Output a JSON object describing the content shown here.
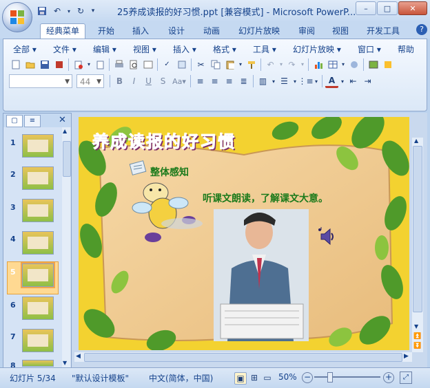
{
  "window": {
    "title": "25养成读报的好习惯.ppt [兼容模式] - Microsoft PowerP..."
  },
  "ribbon_tabs": [
    {
      "label": "经典菜单",
      "active": true
    },
    {
      "label": "开始"
    },
    {
      "label": "插入"
    },
    {
      "label": "设计"
    },
    {
      "label": "动画"
    },
    {
      "label": "幻灯片放映"
    },
    {
      "label": "审阅"
    },
    {
      "label": "视图"
    },
    {
      "label": "开发工具"
    }
  ],
  "classic_menu": [
    "全部",
    "文件",
    "编辑",
    "视图",
    "插入",
    "格式",
    "工具",
    "幻灯片放映",
    "窗口",
    "帮助"
  ],
  "font": {
    "name_placeholder": "",
    "size": "44"
  },
  "left_pane": {
    "slides": [
      {
        "num": "1"
      },
      {
        "num": "2"
      },
      {
        "num": "3"
      },
      {
        "num": "4"
      },
      {
        "num": "5",
        "selected": true
      },
      {
        "num": "6"
      },
      {
        "num": "7"
      },
      {
        "num": "8"
      }
    ]
  },
  "slide": {
    "title": "养成读报的好习惯",
    "section_label": "整体感知",
    "instruction": "听课文朗读，了解课文大意。"
  },
  "status": {
    "slide_counter": "幻灯片 5/34",
    "theme": "\"默认设计模板\"",
    "language": "中文(简体，中国)",
    "zoom": "50%"
  },
  "colors": {
    "ribbon_bg": "#dbe8f7",
    "slide_bg": "#f3d230",
    "title_pink": "#e2338a",
    "instruction_green": "#1b7a1b"
  }
}
